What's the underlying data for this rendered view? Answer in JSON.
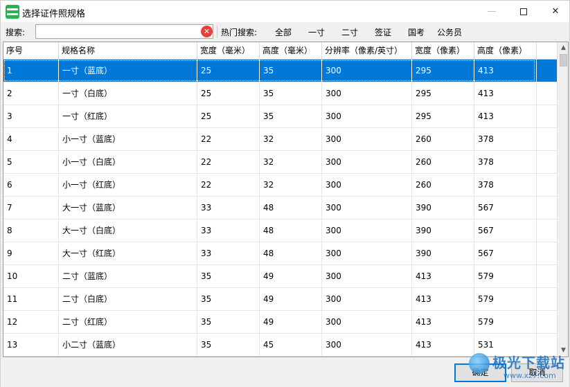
{
  "window": {
    "title": "选择证件照规格",
    "minimize_glyph": "—",
    "close_glyph": "✕"
  },
  "toolbar": {
    "search_label": "搜索:",
    "search_value": "",
    "search_placeholder": "",
    "clear_glyph": "✕",
    "hot_label": "热门搜索:",
    "hot_tags": [
      "全部",
      "一寸",
      "二寸",
      "签证",
      "国考",
      "公务员"
    ]
  },
  "table": {
    "columns": [
      "序号",
      "规格名称",
      "宽度（毫米）",
      "高度（毫米）",
      "分辨率（像素/英寸）",
      "宽度（像素）",
      "高度（像素）"
    ],
    "selected_row": 0,
    "rows": [
      [
        "1",
        "一寸（蓝底）",
        "25",
        "35",
        "300",
        "295",
        "413"
      ],
      [
        "2",
        "一寸（白底）",
        "25",
        "35",
        "300",
        "295",
        "413"
      ],
      [
        "3",
        "一寸（红底）",
        "25",
        "35",
        "300",
        "295",
        "413"
      ],
      [
        "4",
        "小一寸（蓝底）",
        "22",
        "32",
        "300",
        "260",
        "378"
      ],
      [
        "5",
        "小一寸（白底）",
        "22",
        "32",
        "300",
        "260",
        "378"
      ],
      [
        "6",
        "小一寸（红底）",
        "22",
        "32",
        "300",
        "260",
        "378"
      ],
      [
        "7",
        "大一寸（蓝底）",
        "33",
        "48",
        "300",
        "390",
        "567"
      ],
      [
        "8",
        "大一寸（白底）",
        "33",
        "48",
        "300",
        "390",
        "567"
      ],
      [
        "9",
        "大一寸（红底）",
        "33",
        "48",
        "300",
        "390",
        "567"
      ],
      [
        "10",
        "二寸（蓝底）",
        "35",
        "49",
        "300",
        "413",
        "579"
      ],
      [
        "11",
        "二寸（白底）",
        "35",
        "49",
        "300",
        "413",
        "579"
      ],
      [
        "12",
        "二寸（红底）",
        "35",
        "49",
        "300",
        "413",
        "579"
      ],
      [
        "13",
        "小二寸（蓝底）",
        "35",
        "45",
        "300",
        "413",
        "531"
      ]
    ]
  },
  "buttons": {
    "ok_label": "确定",
    "cancel_label": "取消"
  },
  "watermark": {
    "text": "极光下载站",
    "url": "www.xz7.com"
  },
  "colors": {
    "selection": "#0078d7",
    "clear_button": "#e8403b",
    "app_icon": "#2bb24c"
  }
}
